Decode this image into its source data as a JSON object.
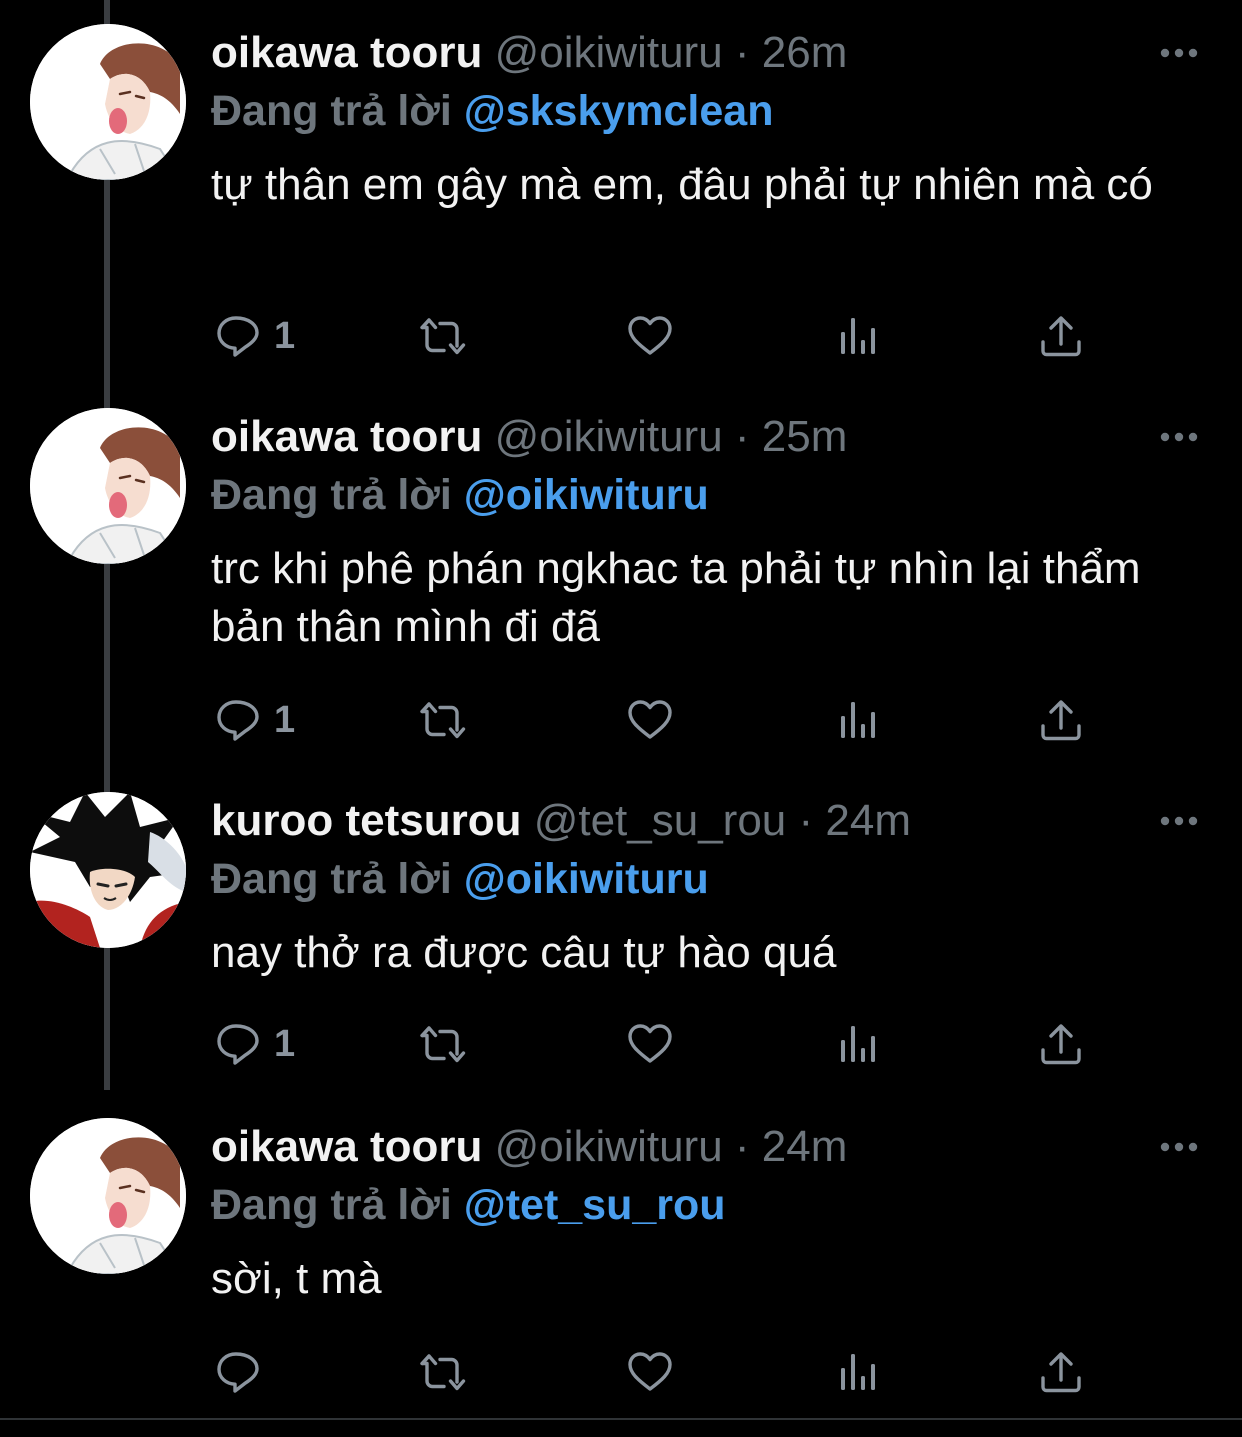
{
  "colors": {
    "background": "#000000",
    "text": "#f2f2f2",
    "muted": "#6e767d",
    "mention": "#4a9eed"
  },
  "icons": {
    "reply": "reply-icon",
    "retweet": "retweet-icon",
    "like": "heart-icon",
    "analytics": "analytics-icon",
    "share": "share-icon",
    "more": "more-icon"
  },
  "tweets": [
    {
      "name": "oikawa tooru",
      "handle": "@oikiwituru",
      "separator": "·",
      "time": "26m",
      "reply_prefix": "Đang trả lời",
      "reply_to": "@skskymclean",
      "text": "tự thân em gây mà em, đâu phải tự nhiên mà có",
      "reply_count": "1",
      "avatar": "oikawa"
    },
    {
      "name": "oikawa tooru",
      "handle": "@oikiwituru",
      "separator": "·",
      "time": "25m",
      "reply_prefix": "Đang trả lời",
      "reply_to": "@oikiwituru",
      "text": "trc khi phê phán ngkhac ta phải tự nhìn lại thẩm bản thân mình đi đã",
      "reply_count": "1",
      "avatar": "oikawa"
    },
    {
      "name": "kuroo tetsurou",
      "handle": "@tet_su_rou",
      "separator": "·",
      "time": "24m",
      "reply_prefix": "Đang trả lời",
      "reply_to": "@oikiwituru",
      "text": "nay thở ra được câu tự hào quá",
      "reply_count": "1",
      "avatar": "kuroo"
    },
    {
      "name": "oikawa tooru",
      "handle": "@oikiwituru",
      "separator": "·",
      "time": "24m",
      "reply_prefix": "Đang trả lời",
      "reply_to": "@tet_su_rou",
      "text": "sời, t mà",
      "reply_count": "",
      "avatar": "oikawa"
    }
  ]
}
